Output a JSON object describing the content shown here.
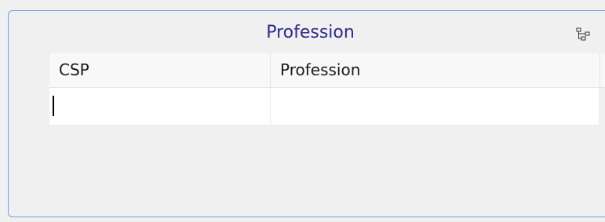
{
  "panel": {
    "title": "Profession",
    "tree_icon": "tree-structure-icon"
  },
  "grid": {
    "columns": [
      "CSP",
      "Profession"
    ],
    "rows": [
      {
        "csp": "",
        "profession": ""
      }
    ]
  },
  "colors": {
    "title": "#2e2a8a",
    "border": "#7aa2d8",
    "background": "#f0f0f0"
  }
}
